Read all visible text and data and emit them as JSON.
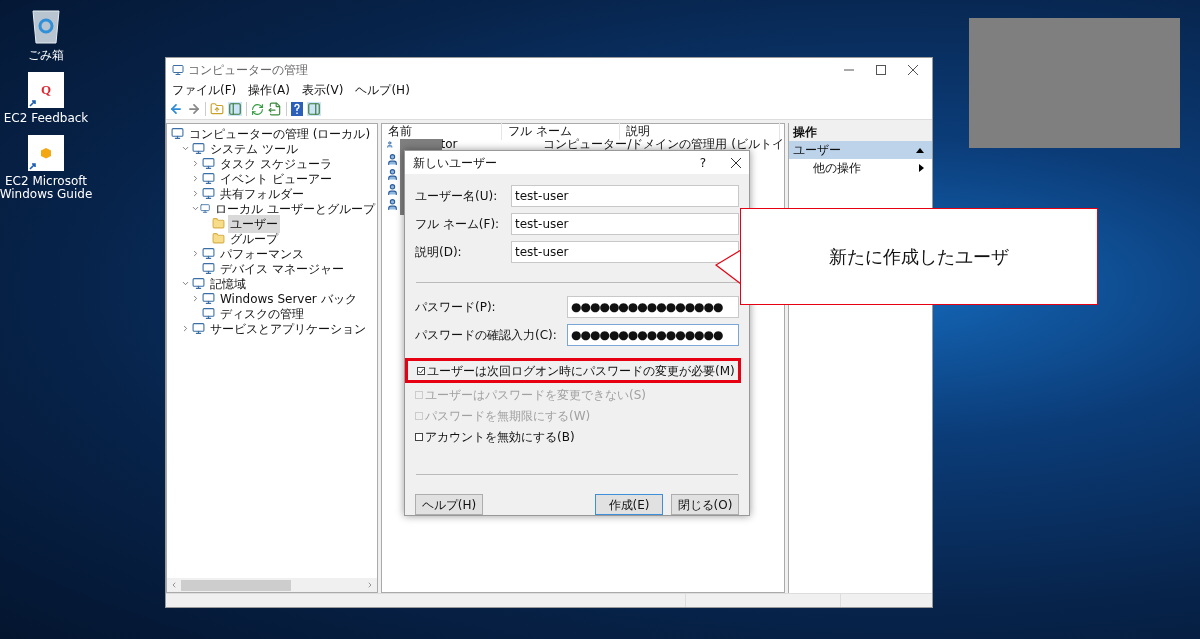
{
  "desktop_icons": [
    {
      "kind": "recycle",
      "label": "ごみ箱"
    },
    {
      "kind": "tile",
      "glyph": "Q",
      "label": "EC2 Feedback"
    },
    {
      "kind": "cube",
      "label": "EC2 Microsoft Windows Guide"
    }
  ],
  "window": {
    "title": "コンピューターの管理",
    "menu": [
      "ファイル(F)",
      "操作(A)",
      "表示(V)",
      "ヘルプ(H)"
    ],
    "tree": [
      {
        "label": "コンピューターの管理 (ローカル)",
        "selected": false,
        "children": [
          {
            "label": "システム ツール",
            "expanded": true,
            "selected": false,
            "children": [
              {
                "label": "タスク スケジューラ",
                "expanded": false,
                "selected": false
              },
              {
                "label": "イベント ビューアー",
                "expanded": false,
                "selected": false
              },
              {
                "label": "共有フォルダー",
                "expanded": false,
                "selected": false
              },
              {
                "label": "ローカル ユーザーとグループ",
                "expanded": true,
                "selected": false,
                "children": [
                  {
                    "label": "ユーザー",
                    "selected": true
                  },
                  {
                    "label": "グループ",
                    "selected": false
                  }
                ]
              },
              {
                "label": "パフォーマンス",
                "expanded": false,
                "selected": false
              },
              {
                "label": "デバイス マネージャー",
                "selected": false
              }
            ]
          },
          {
            "label": "記憶域",
            "expanded": true,
            "selected": false,
            "children": [
              {
                "label": "Windows Server バック",
                "expanded": false,
                "selected": false
              },
              {
                "label": "ディスクの管理",
                "selected": false
              }
            ]
          },
          {
            "label": "サービスとアプリケーション",
            "expanded": false,
            "selected": false
          }
        ]
      }
    ],
    "list": {
      "columns": [
        "名前",
        "フル ネーム",
        "説明"
      ],
      "rows": [
        {
          "kind": "user",
          "name": "tor",
          "description": "コンピューター/ドメインの管理用 (ビルトイ"
        },
        {
          "kind": "user"
        },
        {
          "kind": "user"
        },
        {
          "kind": "user"
        },
        {
          "kind": "user"
        }
      ]
    },
    "actions": {
      "header": "操作",
      "items": [
        {
          "label": "ユーザー",
          "selected": true
        },
        {
          "label": "他の操作",
          "selected": false
        }
      ]
    }
  },
  "dialog": {
    "title": "新しいユーザー",
    "help": "?",
    "fields": [
      {
        "label": "ユーザー名(U):",
        "value": "test-user",
        "kind": "text"
      },
      {
        "label": "フル ネーム(F):",
        "value": "test-user",
        "kind": "text"
      },
      {
        "label": "説明(D):",
        "value": "test-user",
        "kind": "text"
      },
      {
        "label": "パスワード(P):",
        "value": "●●●●●●●●●●●●●●●●",
        "kind": "password"
      },
      {
        "label": "パスワードの確認入力(C):",
        "value": "●●●●●●●●●●●●●●●●",
        "kind": "password"
      }
    ],
    "checkboxes": [
      {
        "label": "ユーザーは次回ログオン時にパスワードの変更が必要(M)",
        "checked": true,
        "disabled": false,
        "highlighted": true
      },
      {
        "label": "ユーザーはパスワードを変更できない(S)",
        "checked": false,
        "disabled": true,
        "highlighted": false
      },
      {
        "label": "パスワードを無期限にする(W)",
        "checked": false,
        "disabled": true,
        "highlighted": false
      },
      {
        "label": "アカウントを無効にする(B)",
        "checked": false,
        "disabled": false,
        "highlighted": false
      }
    ],
    "buttons": [
      {
        "label": "ヘルプ(H)",
        "selected": false
      },
      {
        "label": "作成(E)",
        "selected": true
      },
      {
        "label": "閉じる(O)",
        "selected": false
      }
    ]
  },
  "callout": {
    "text": "新たに作成したユーザ"
  }
}
